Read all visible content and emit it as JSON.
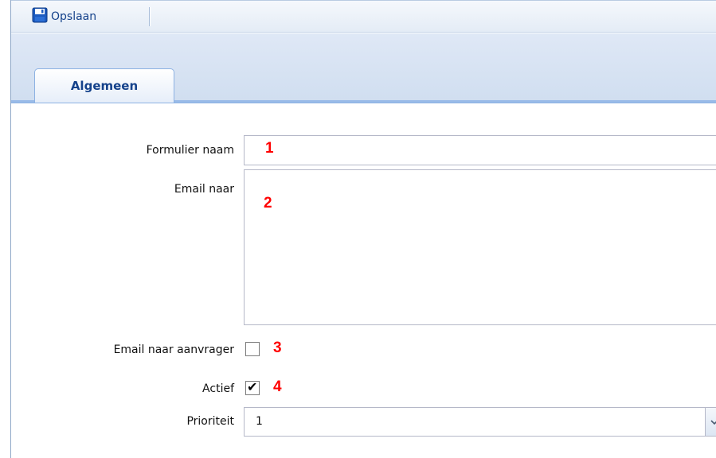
{
  "toolbar": {
    "save_label": "Opslaan",
    "save_icon": "floppy-disk-icon"
  },
  "tabs": [
    {
      "label": "Algemeen",
      "active": true
    }
  ],
  "form": {
    "form_name": {
      "label": "Formulier naam",
      "value": "",
      "annotation": "1"
    },
    "email_to": {
      "label": "Email naar",
      "value": "",
      "annotation": "2"
    },
    "email_requester": {
      "label": "Email naar aanvrager",
      "checked": false,
      "annotation": "3"
    },
    "active": {
      "label": "Actief",
      "checked": true,
      "annotation": "4"
    },
    "priority": {
      "label": "Prioriteit",
      "selected": "1"
    }
  },
  "colors": {
    "accent": "#15428b",
    "annotation": "#ff0000",
    "toolbar_bg": "#e4ecf6",
    "tab_border": "#8db2e3"
  }
}
